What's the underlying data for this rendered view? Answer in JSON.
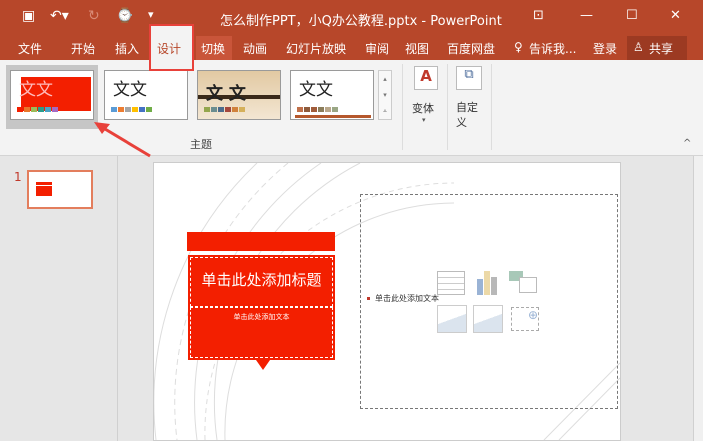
{
  "titlebar": {
    "title": "怎么制作PPT，小Q办公教程.pptx - PowerPoint",
    "save_icon": "save-icon",
    "undo_icon": "undo-icon",
    "redo_icon": "redo-icon",
    "present_icon": "present-icon",
    "customize": "▾",
    "ribbon_display": "⊡",
    "minimize": "—",
    "maximize": "☐",
    "close": "✕"
  },
  "tabs": [
    "文件",
    "开始",
    "插入",
    "设计",
    "切换",
    "动画",
    "幻灯片放映",
    "审阅",
    "视图",
    "百度网盘"
  ],
  "active_tab": "设计",
  "tell_me": "告诉我...",
  "login": "登录",
  "share": "共享",
  "ribbon": {
    "themes": [
      {
        "label": "文文"
      },
      {
        "label": "文文"
      },
      {
        "label": "文 文"
      },
      {
        "label": "文文"
      }
    ],
    "group_label": "主题",
    "variants": "变体",
    "customize": "自定义",
    "collapse": "^"
  },
  "slides": {
    "number": "1"
  },
  "slide": {
    "title_placeholder": "单击此处添加标题",
    "subtitle_placeholder": "单击此处添加文本",
    "content_placeholder": "单击此处添加文本"
  },
  "colors": {
    "accent": "#b7472a",
    "slide_red": "#f31f00"
  }
}
